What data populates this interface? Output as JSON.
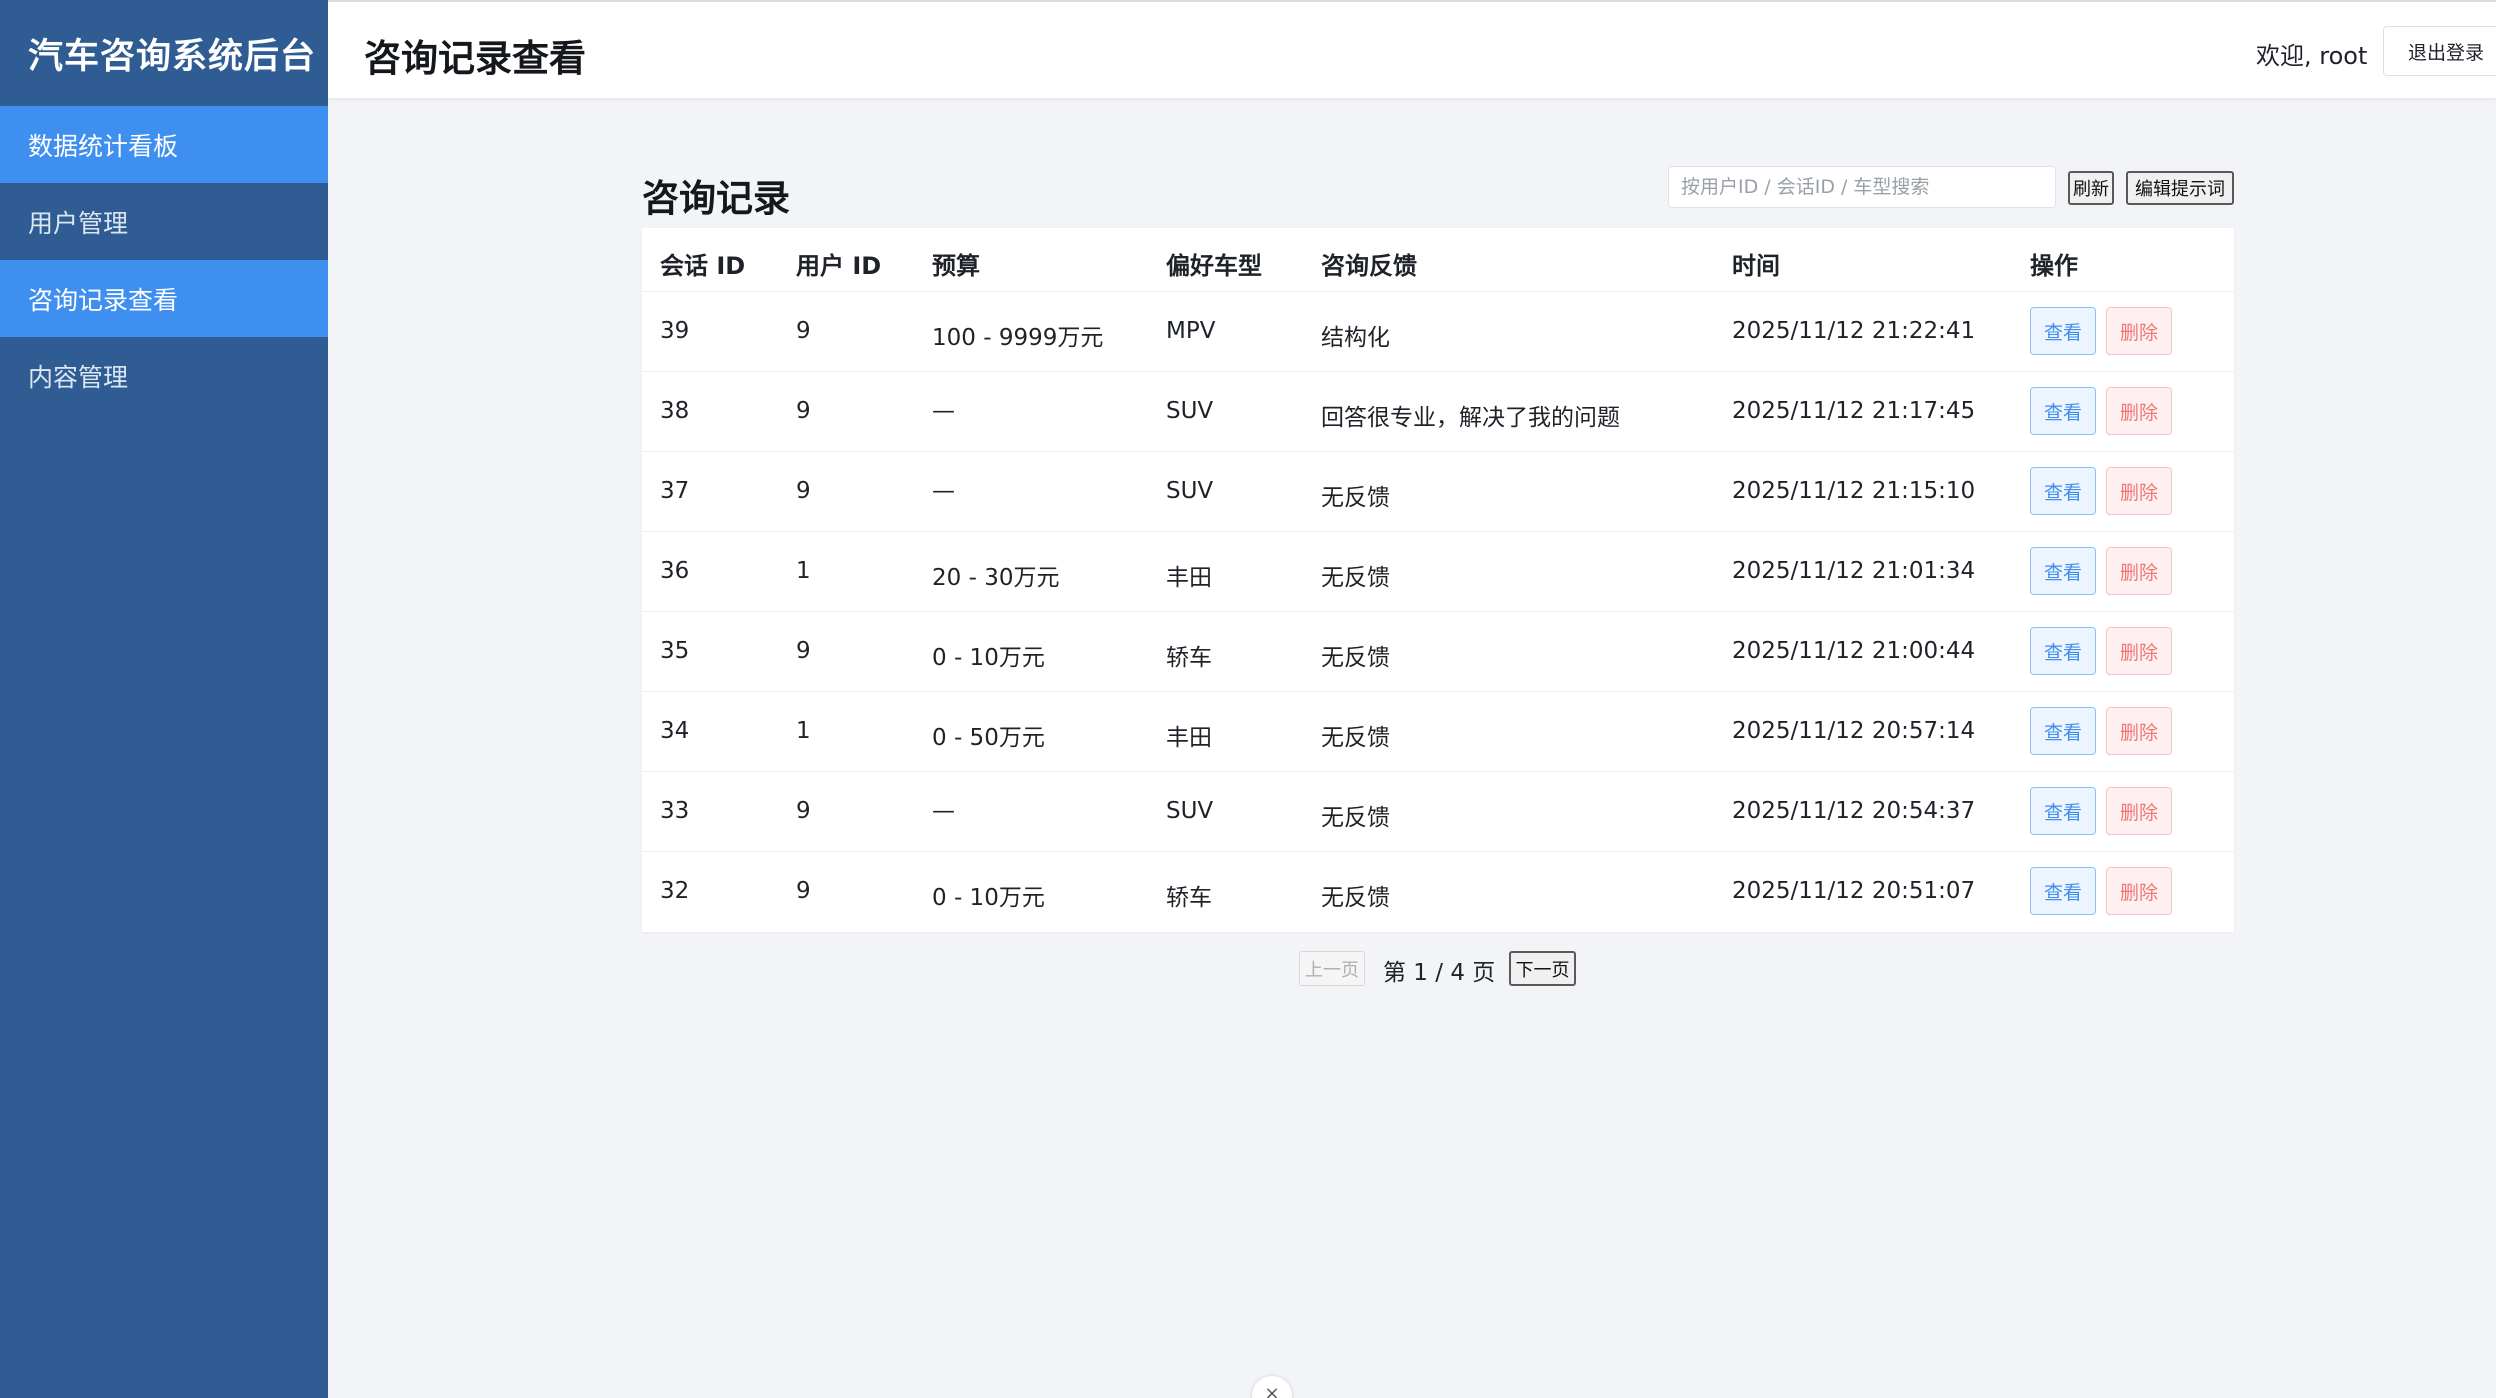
{
  "sidebar": {
    "brand": "汽车咨询系统后台",
    "items": [
      {
        "label": "数据统计看板",
        "active": true
      },
      {
        "label": "用户管理",
        "active": false
      },
      {
        "label": "咨询记录查看",
        "active": true
      },
      {
        "label": "内容管理",
        "active": false
      }
    ]
  },
  "header": {
    "title": "咨询记录查看",
    "welcome": "欢迎, root",
    "logout_label": "退出登录"
  },
  "section": {
    "title": "咨询记录",
    "search_placeholder": "按用户ID / 会话ID / 车型搜索",
    "refresh_label": "刷新",
    "edit_prompt_label": "编辑提示词"
  },
  "table": {
    "columns": [
      "会话 ID",
      "用户 ID",
      "预算",
      "偏好车型",
      "咨询反馈",
      "时间",
      "操作"
    ],
    "view_label": "查看",
    "delete_label": "删除",
    "rows": [
      {
        "id": "39",
        "uid": "9",
        "budget": "100 - 9999万元",
        "car": "MPV",
        "feedback": "结构化",
        "time": "2025/11/12 21:22:41"
      },
      {
        "id": "38",
        "uid": "9",
        "budget": "—",
        "car": "SUV",
        "feedback": "回答很专业，解决了我的问题",
        "time": "2025/11/12 21:17:45"
      },
      {
        "id": "37",
        "uid": "9",
        "budget": "—",
        "car": "SUV",
        "feedback": "无反馈",
        "time": "2025/11/12 21:15:10"
      },
      {
        "id": "36",
        "uid": "1",
        "budget": "20 - 30万元",
        "car": "丰田",
        "feedback": "无反馈",
        "time": "2025/11/12 21:01:34"
      },
      {
        "id": "35",
        "uid": "9",
        "budget": "0 - 10万元",
        "car": "轿车",
        "feedback": "无反馈",
        "time": "2025/11/12 21:00:44"
      },
      {
        "id": "34",
        "uid": "1",
        "budget": "0 - 50万元",
        "car": "丰田",
        "feedback": "无反馈",
        "time": "2025/11/12 20:57:14"
      },
      {
        "id": "33",
        "uid": "9",
        "budget": "—",
        "car": "SUV",
        "feedback": "无反馈",
        "time": "2025/11/12 20:54:37"
      },
      {
        "id": "32",
        "uid": "9",
        "budget": "0 - 10万元",
        "car": "轿车",
        "feedback": "无反馈",
        "time": "2025/11/12 20:51:07"
      }
    ]
  },
  "pagination": {
    "prev_label": "上一页",
    "info": "第 1 / 4 页",
    "next_label": "下一页"
  },
  "bottom_widget": {
    "glyph": "×",
    "icon": "close-icon"
  }
}
